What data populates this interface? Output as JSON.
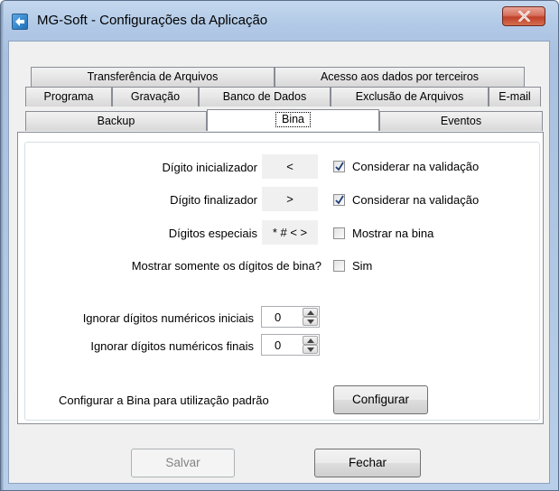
{
  "window": {
    "title": "MG-Soft - Configurações da Aplicação"
  },
  "tabs": {
    "row1": [
      "Transferência de Arquivos",
      "Acesso aos dados por terceiros"
    ],
    "row2": [
      "Programa",
      "Gravação",
      "Banco de Dados",
      "Exclusão de Arquivos",
      "E-mail"
    ],
    "row3": [
      "Backup",
      "Bina",
      "Eventos"
    ],
    "active": "Bina"
  },
  "bina": {
    "digito_inicializador": {
      "label": "Dígito inicializador",
      "value": "<",
      "check_label": "Considerar na validação",
      "checked": true
    },
    "digito_finalizador": {
      "label": "Dígito finalizador",
      "value": ">",
      "check_label": "Considerar na validação",
      "checked": true
    },
    "digitos_especiais": {
      "label": "Dígitos especiais",
      "value": "* # < >",
      "check_label": "Mostrar na bina",
      "checked": false
    },
    "mostrar_somente": {
      "label": "Mostrar somente os dígitos de bina?",
      "check_label": "Sim",
      "checked": false
    },
    "ignorar_iniciais": {
      "label": "Ignorar dígitos numéricos iniciais",
      "value": "0"
    },
    "ignorar_finais": {
      "label": "Ignorar dígitos numéricos finais",
      "value": "0"
    },
    "configurar": {
      "label": "Configurar a Bina para utilização padrão",
      "button": "Configurar"
    }
  },
  "footer": {
    "save_label": "Salvar",
    "close_label": "Fechar"
  },
  "colors": {
    "title_gradient_top": "#c4d7ee",
    "close_red": "#c0402a",
    "check_mark": "#1c3d7a"
  }
}
